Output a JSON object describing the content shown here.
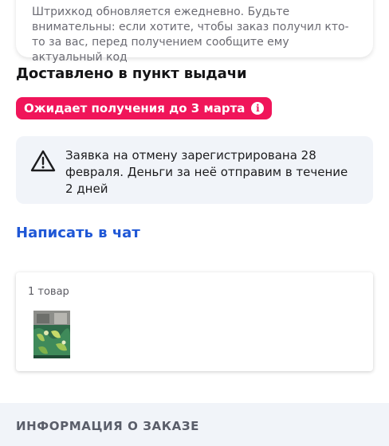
{
  "barcode": {
    "note": "Штрихкод обновляется ежедневно. Будьте внимательны: если хотите, чтобы заказ получил кто-то за вас, перед получением сообщите ему актуальный код"
  },
  "delivery": {
    "status_title": "Доставлено в пункт выдачи",
    "badge_label": "Ожидает получения до 3 марта",
    "badge_color": "#f0155a"
  },
  "cancellation": {
    "message": "Заявка на отмену зарегистрирована 28 февраля. Деньги за неё отправим в течение 2 дней"
  },
  "chat": {
    "link_label": "Написать в чат",
    "link_color": "#1f57d6"
  },
  "items": {
    "count_label": "1 товар"
  },
  "order_info": {
    "section_title": "ИНФОРМАЦИЯ О ЗАКАЗЕ"
  }
}
